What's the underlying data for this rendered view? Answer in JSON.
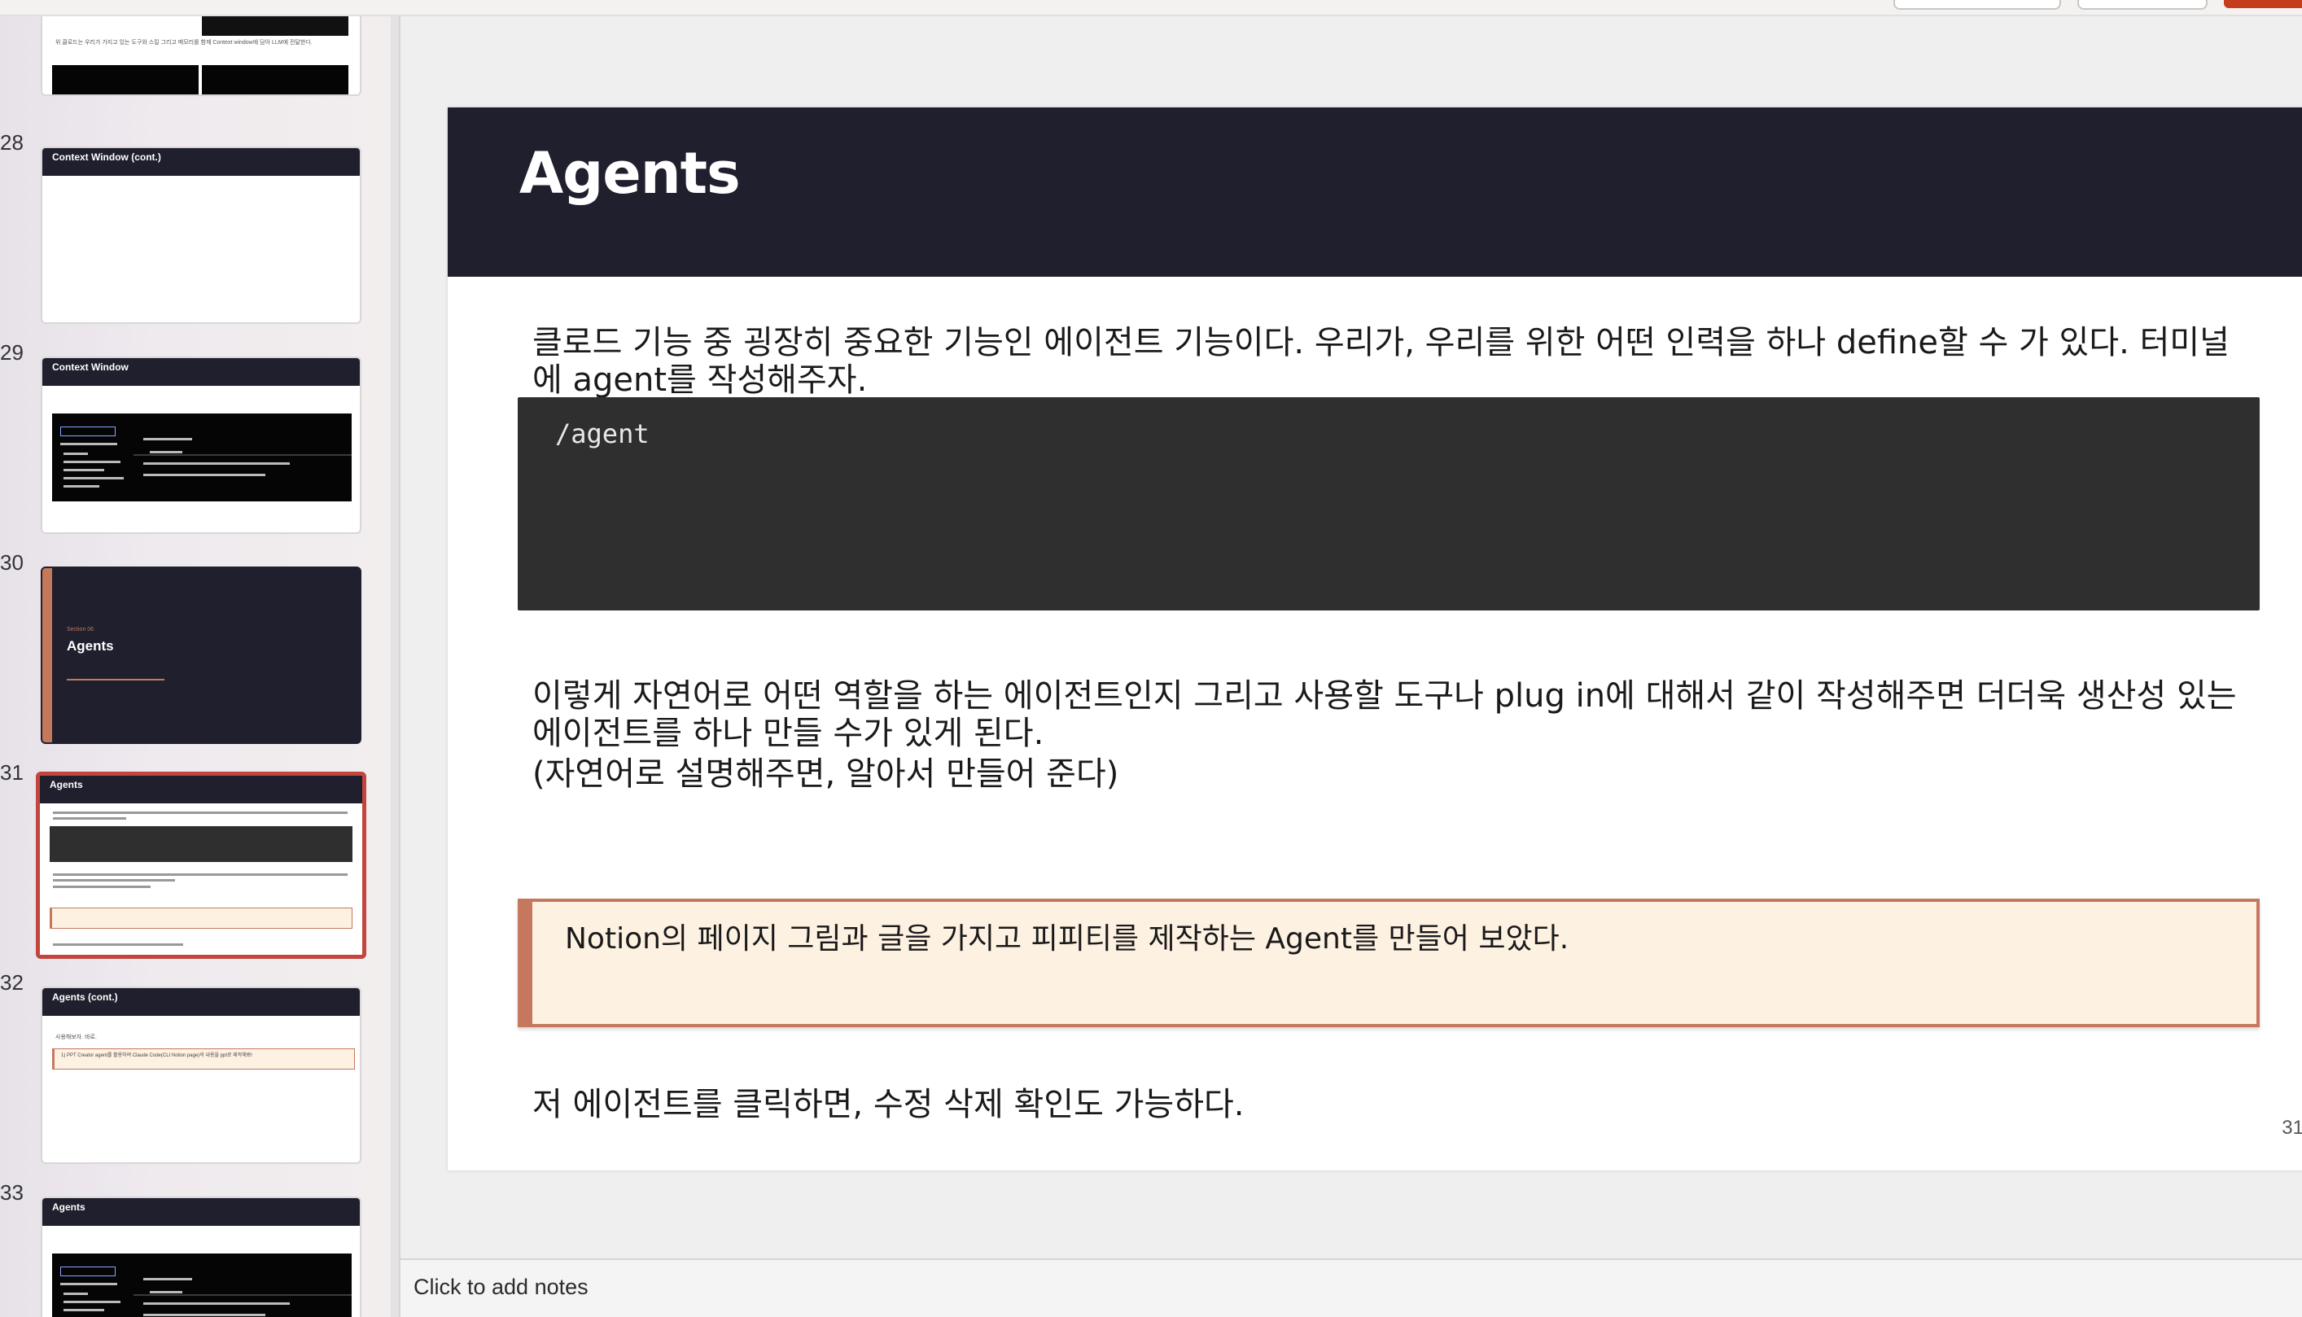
{
  "thumbnails": [
    {
      "number": "",
      "title": "",
      "caption": "위 클로드는 우리가 가지고 있는 도구와 스킬 그리고 메모리를 함께 Context window에 담아 LLM에 전달한다."
    },
    {
      "number": "28",
      "title": "Context Window (cont.)"
    },
    {
      "number": "29",
      "title": "Context Window"
    },
    {
      "number": "30",
      "title": "Agents",
      "subtitle": "Section 06"
    },
    {
      "number": "31",
      "title": "Agents",
      "selected": true
    },
    {
      "number": "32",
      "title": "Agents (cont.)",
      "caption": "사용해보자. 바로.",
      "callout": "1) PPT Creator agent를 활용하여 Claude Code(CLI Notion page)의 내용을 ppt로 제작해봐!"
    },
    {
      "number": "33",
      "title": "Agents"
    }
  ],
  "slide": {
    "title": "Agents",
    "para1": "클로드 기능 중 굉장히 중요한 기능인 에이전트 기능이다. 우리가, 우리를 위한 어떤 인력을 하나 define할 수 가 있다. 터미널에 agent를 작성해주자.",
    "code": "/agent",
    "para2": "이렇게 자연어로 어떤 역할을 하는 에이전트인지 그리고 사용할 도구나 plug in에 대해서 같이 작성해주면 더더욱 생산성 있는 에이전트를 하나 만들 수가 있게 된다.",
    "para3": "(자연어로 설명해주면, 알아서 만들어 준다)",
    "callout": "Notion의 페이지 그림과 글을 가지고 피피티를 제작하는 Agent를 만들어 보았다.",
    "para4": "저 에이전트를 클릭하면, 수정 삭제 확인도 가능하다.",
    "number": "31"
  },
  "notes": {
    "placeholder": "Click to add notes"
  }
}
